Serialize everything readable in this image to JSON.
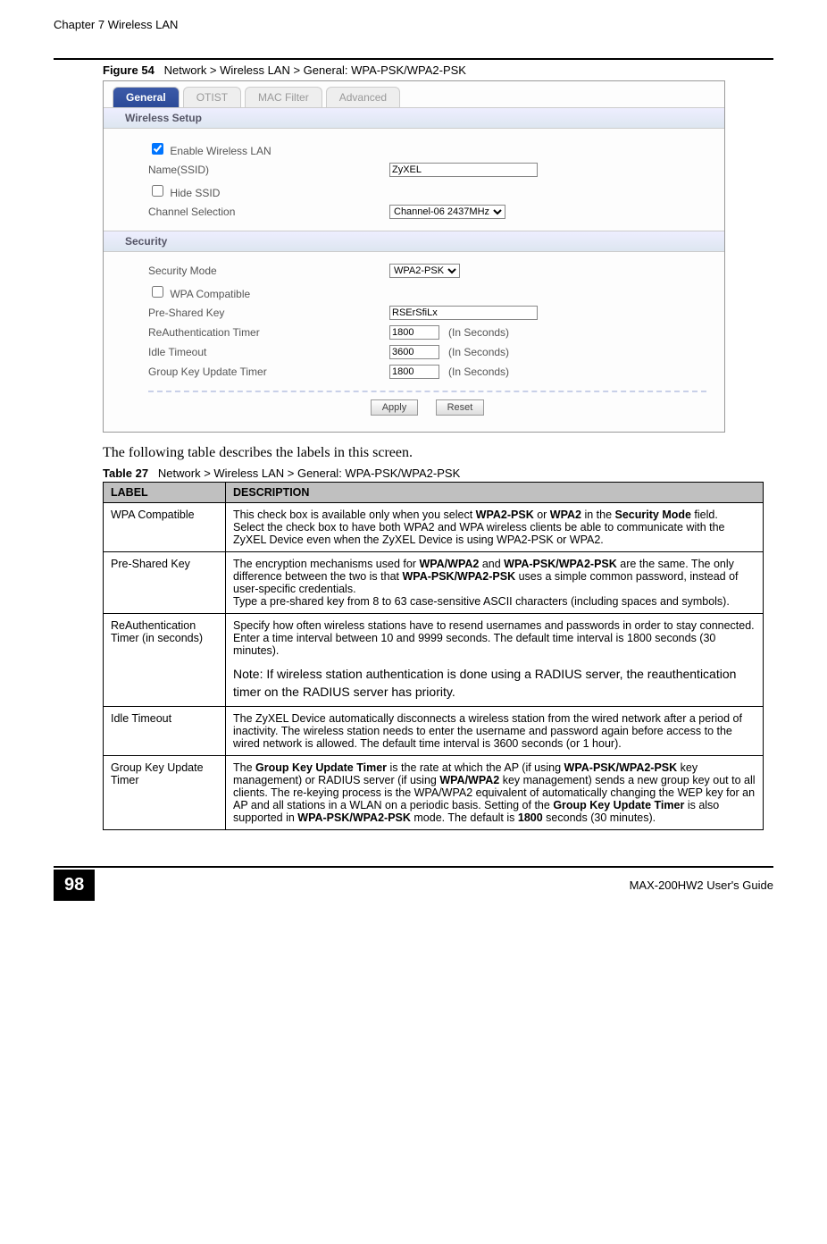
{
  "header": {
    "chapter": "Chapter 7 Wireless LAN"
  },
  "figure": {
    "label": "Figure 54",
    "caption": "Network > Wireless LAN > General: WPA-PSK/WPA2-PSK"
  },
  "tabs": {
    "general": "General",
    "otist": "OTIST",
    "mac": "MAC Filter",
    "advanced": "Advanced"
  },
  "sections": {
    "wireless": "Wireless Setup",
    "security": "Security"
  },
  "form": {
    "enable_wlan": "Enable Wireless LAN",
    "name_ssid": "Name(SSID)",
    "ssid_value": "ZyXEL",
    "hide_ssid": "Hide SSID",
    "channel_sel": "Channel Selection",
    "channel_value": "Channel-06 2437MHz",
    "sec_mode": "Security Mode",
    "sec_mode_value": "WPA2-PSK",
    "wpa_compat": "WPA Compatible",
    "psk_label": "Pre-Shared Key",
    "psk_value": "RSErSfiLx",
    "reauth_label": "ReAuthentication Timer",
    "reauth_value": "1800",
    "idle_label": "Idle Timeout",
    "idle_value": "3600",
    "gku_label": "Group Key Update Timer",
    "gku_value": "1800",
    "seconds_hint": "(In Seconds)",
    "apply": "Apply",
    "reset": "Reset"
  },
  "intro_text": "The following table describes the labels in this screen.",
  "table_caption_label": "Table 27",
  "table_caption_text": "Network > Wireless LAN > General: WPA-PSK/WPA2-PSK",
  "table_header": {
    "label": "LABEL",
    "desc": "DESCRIPTION"
  },
  "rows": {
    "r1_label": "WPA Compatible",
    "r1_desc_a": "This check box is available only when you select ",
    "r1_desc_b": "WPA2-PSK",
    "r1_desc_c": " or ",
    "r1_desc_d": "WPA2",
    "r1_desc_e": " in the ",
    "r1_desc_f": "Security Mode",
    "r1_desc_g": " field.",
    "r1_desc_h": "Select the check box to have both WPA2 and WPA wireless clients be able to communicate with the ZyXEL Device even when the ZyXEL Device is using WPA2-PSK or WPA2.",
    "r2_label": "Pre-Shared Key",
    "r2_desc_a": "The encryption mechanisms used for ",
    "r2_desc_b": "WPA/WPA2",
    "r2_desc_c": " and ",
    "r2_desc_d": "WPA-PSK/WPA2-PSK",
    "r2_desc_e": " are the same. The only difference between the two is that ",
    "r2_desc_f": "WPA-PSK/WPA2-PSK",
    "r2_desc_g": " uses a simple common password, instead of user-specific credentials.",
    "r2_desc_h": "Type a pre-shared key from 8 to 63 case-sensitive ASCII characters (including spaces and symbols).",
    "r3_label": "ReAuthentication Timer (in seconds)",
    "r3_desc_a": "Specify how often wireless stations have to resend usernames and passwords in order to stay connected. Enter a time interval between 10 and 9999 seconds. The default time interval is 1800 seconds (30 minutes).",
    "r3_note": "Note: If wireless station authentication is done using a RADIUS server, the reauthentication timer on the RADIUS server has priority.",
    "r4_label": "Idle Timeout",
    "r4_desc": "The ZyXEL Device automatically disconnects a wireless station from the wired network after a period of inactivity. The wireless station needs to enter the username and password again before access to the wired network is allowed. The default time interval is 3600 seconds (or 1 hour).",
    "r5_label": "Group Key Update Timer",
    "r5_a": "The ",
    "r5_b": "Group Key Update Timer",
    "r5_c": " is the rate at which the AP (if using ",
    "r5_d": "WPA-PSK/WPA2-PSK",
    "r5_e": " key management) or RADIUS server (if using ",
    "r5_f": "WPA/WPA2",
    "r5_g": " key management) sends a new group key out to all clients. The re-keying process is the WPA/WPA2 equivalent of automatically changing the WEP key for an AP and all stations in a WLAN on a periodic basis. Setting of the ",
    "r5_h": "Group Key Update Timer",
    "r5_i": " is also supported in ",
    "r5_j": "WPA-PSK/WPA2-PSK",
    "r5_k": " mode. The default is ",
    "r5_l": "1800",
    "r5_m": " seconds (30 minutes)."
  },
  "footer": {
    "page": "98",
    "guide": "MAX-200HW2 User's Guide"
  }
}
